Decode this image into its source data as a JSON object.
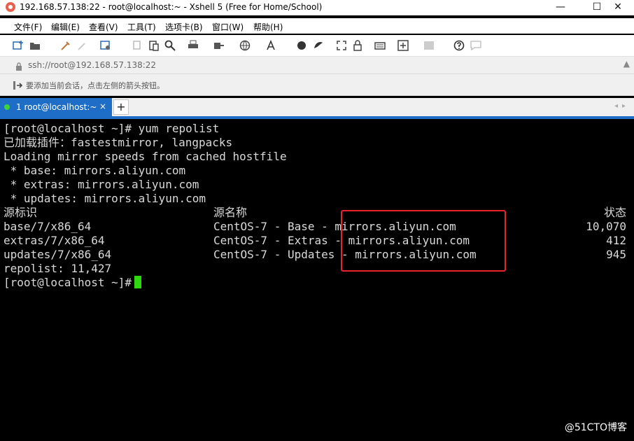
{
  "window": {
    "title": "192.168.57.138:22 - root@localhost:~ - Xshell 5 (Free for Home/School)",
    "minimize": "—",
    "maximize": "☐",
    "close": "✕"
  },
  "menu": [
    "文件(F)",
    "编辑(E)",
    "查看(V)",
    "工具(T)",
    "选项卡(B)",
    "窗口(W)",
    "帮助(H)"
  ],
  "address": {
    "text": "ssh://root@192.168.57.138:22",
    "right": "▲"
  },
  "hint": {
    "text": "要添加当前会话，点击左侧的箭头按钮。"
  },
  "tab": {
    "label": "1 root@localhost:~",
    "close": "×",
    "add": "+",
    "nav": "◂▸"
  },
  "terminal": {
    "lines": [
      "[root@localhost ~]# yum repolist",
      "已加载插件：fastestmirror, langpacks",
      "Loading mirror speeds from cached hostfile",
      " * base: mirrors.aliyun.com",
      " * extras: mirrors.aliyun.com",
      " * updates: mirrors.aliyun.com"
    ],
    "table": {
      "headers": [
        "源标识",
        "源名称",
        "状态"
      ],
      "rows": [
        [
          "base/7/x86_64",
          "CentOS-7 - Base - mirrors.aliyun.com",
          "10,070"
        ],
        [
          "extras/7/x86_64",
          "CentOS-7 - Extras - mirrors.aliyun.com",
          "412"
        ],
        [
          "updates/7/x86_64",
          "CentOS-7 - Updates - mirrors.aliyun.com",
          "945"
        ]
      ]
    },
    "summary": "repolist: 11,427",
    "prompt": "[root@localhost ~]#"
  },
  "watermark": "@51CTO博客",
  "colors": {
    "tab_active": "#1e6ec8",
    "cursor": "#2dd80e",
    "highlight": "#e8242b"
  }
}
